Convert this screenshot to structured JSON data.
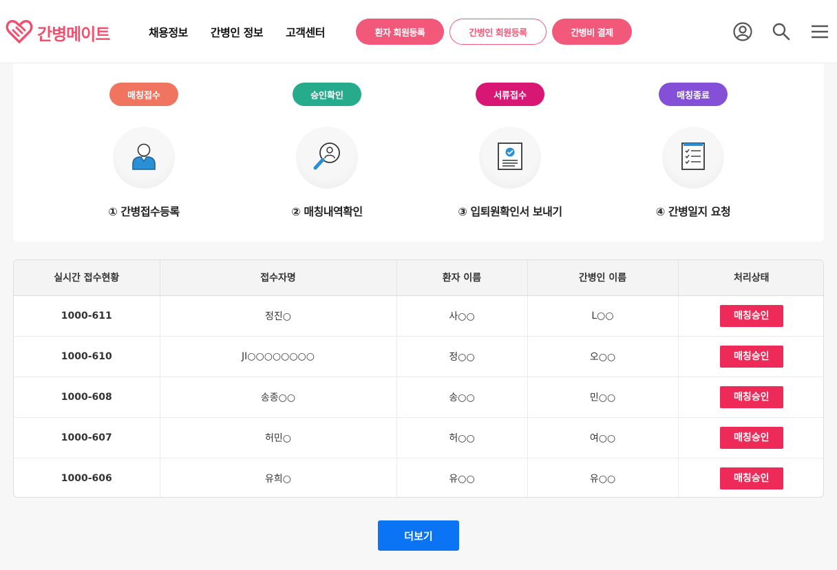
{
  "header": {
    "logo_text": "간병메이트",
    "brand_color": "#f0506e",
    "nav": [
      "채용정보",
      "간병인 정보",
      "고객센터"
    ],
    "buttons": {
      "patient_signup": "환자 회원등록",
      "caregiver_signup": "간병인 회원등록",
      "payment": "간병비 결제"
    },
    "icons": [
      "user-circle-icon",
      "search-icon",
      "hamburger-menu-icon"
    ]
  },
  "steps": [
    {
      "badge": "매칭접수",
      "badge_color": "#ef7560",
      "icon": "person-icon",
      "label": "① 간병접수등록"
    },
    {
      "badge": "승인확인",
      "badge_color": "#27ab8d",
      "icon": "magnifier-person-icon",
      "label": "② 매칭내역확인"
    },
    {
      "badge": "서류접수",
      "badge_color": "#d81775",
      "icon": "document-check-icon",
      "label": "③ 입퇴원확인서 보내기"
    },
    {
      "badge": "매칭종료",
      "badge_color": "#8450d8",
      "icon": "checklist-icon",
      "label": "④ 간병일지 요청"
    }
  ],
  "table": {
    "headers": [
      "실시간 접수현황",
      "접수자명",
      "환자 이름",
      "간병인 이름",
      "처리상태"
    ],
    "rows": [
      {
        "id": "1000-611",
        "applicant": "정진○",
        "patient": "사○○",
        "caregiver": "L○○",
        "status": "매칭승인"
      },
      {
        "id": "1000-610",
        "applicant": "JI○○○○○○○○",
        "patient": "정○○",
        "caregiver": "오○○",
        "status": "매칭승인"
      },
      {
        "id": "1000-608",
        "applicant": "송종○○",
        "patient": "송○○",
        "caregiver": "민○○",
        "status": "매칭승인"
      },
      {
        "id": "1000-607",
        "applicant": "허민○",
        "patient": "허○○",
        "caregiver": "여○○",
        "status": "매칭승인"
      },
      {
        "id": "1000-606",
        "applicant": "유희○",
        "patient": "유○○",
        "caregiver": "유○○",
        "status": "매칭승인"
      }
    ],
    "status_color": "#ee2a58"
  },
  "more_button": "더보기",
  "more_button_color": "#0b74f5"
}
